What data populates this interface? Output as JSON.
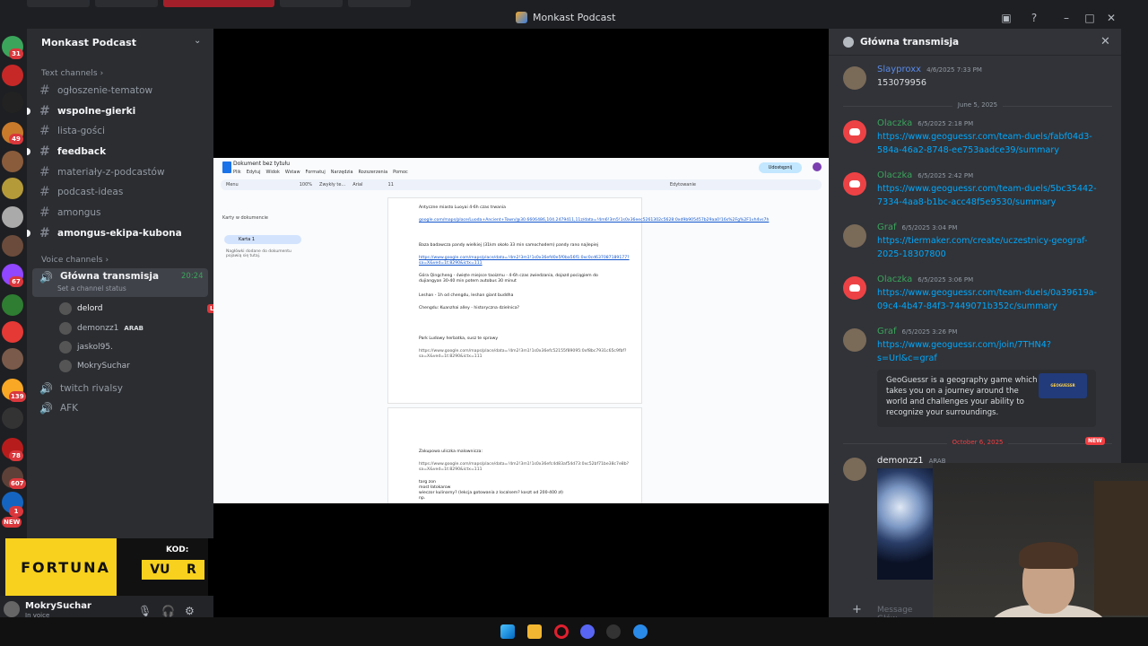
{
  "window": {
    "title": "Monkast Podcast"
  },
  "guild_badges": [
    "31",
    "49",
    "67",
    "139",
    "78",
    "607",
    "1",
    "NEW"
  ],
  "server": {
    "name": "Monkast Podcast",
    "text_category": "Text channels",
    "text_channels": [
      {
        "name": "ogłoszenie-tematow",
        "unread": false
      },
      {
        "name": "wspolne-gierki",
        "unread": true
      },
      {
        "name": "lista-gości",
        "unread": false
      },
      {
        "name": "feedback",
        "unread": true
      },
      {
        "name": "materiały-z-podcastów",
        "unread": false
      },
      {
        "name": "podcast-ideas",
        "unread": false
      },
      {
        "name": "amongus",
        "unread": false
      },
      {
        "name": "amongus-ekipa-kubona",
        "unread": true
      }
    ],
    "voice_category": "Voice channels",
    "active_voice": {
      "name": "Główna transmisja",
      "timer": "20:24",
      "status": "Set a channel status"
    },
    "voice_users": [
      {
        "name": "delord",
        "tag": "LIVE"
      },
      {
        "name": "demonzz1",
        "tag": "ARAB"
      },
      {
        "name": "jaskol95.",
        "tag": ""
      },
      {
        "name": "MokrySuchar",
        "tag": ""
      }
    ],
    "voice_channels": [
      "twitch rivalsy",
      "AFK"
    ]
  },
  "ad": {
    "brand": "FORTUNA",
    "code_label": "KOD:",
    "code_left": "VU",
    "code_right": "R"
  },
  "user": {
    "name": "MokrySuchar",
    "status": "In voice"
  },
  "docs": {
    "title": "Dokument bez tytułu",
    "menus": [
      "Plik",
      "Edytuj",
      "Widok",
      "Wstaw",
      "Formatuj",
      "Narzędzia",
      "Rozszerzenia",
      "Pomoc"
    ],
    "share": "Udostępnij",
    "toolbar": [
      "Menu",
      "100%",
      "Zwykły te...",
      "Arial",
      "11",
      "Edytowanie"
    ],
    "side_title": "Karty w dokumencie",
    "side_tab": "Karta 1",
    "side_hint": "Nagłówki dodane do dokumentu pojawią się tutaj.",
    "lines": [
      {
        "text": "Antyczne miasto Luoyai 4-6h czas trwania",
        "kind": "plain"
      },
      {
        "text": "google.com/maps/place/Luoda+Ancient+Town/@30.6606486,104.2479411,11z/data=!4m6!3m5!1s0x36eec5261302c5628:0xd9b905457b29aa0!16s%2Fg%2F1vh4vs7h",
        "kind": "link"
      },
      {
        "text": "Baza badawcza pandy wielkiej (31km około 33 min samochodem) pandy rano najlepiej",
        "kind": "plain"
      },
      {
        "text": "https://www.google.com/maps/place/data=!4m2!3m1!1s0x36efd0e5f0ba56f1:0xc0cd637087189177?sa=X&ved=1t:8290&ictx=111",
        "kind": "link"
      },
      {
        "text": "Góra Qingcheng - święte miejsce taoizmu - 4-6h czas zwiedzania, dojazd pociągiem do dujiangyan 30-40 min potem autobus 30 minut",
        "kind": "plain"
      },
      {
        "text": "Leshan - 1h od chengdu, leshan giant buddha",
        "kind": "plain"
      },
      {
        "text": "Chengdu: Kuanzhai alley - historyczna dzielnica?",
        "kind": "plain"
      },
      {
        "text": "Park Ludowy herbatka, susz te sprawy",
        "kind": "plain"
      },
      {
        "text": "https://www.google.com/maps/place/data=!4m2!3m1!1s0x36efc52155f89095:0xf8bc7931c65c9fbf?sa=X&ved=1t:8290&ictx=111",
        "kind": "gray"
      },
      {
        "text": "Zakupowa uliczka malownicza:",
        "kind": "plain"
      },
      {
        "text": "https://www.google.com/maps/place/data=!4m2!3m1!1s0x36efc4d83af54d73:0xc52bf71be38c7e8b?sa=X&ved=1t:8290&ictx=111",
        "kind": "gray"
      },
      {
        "text": "targ zon",
        "kind": "plain"
      },
      {
        "text": "most łatokarow",
        "kind": "plain"
      },
      {
        "text": "wieczor kulinarny? (lekcja gotowania z localsem? koszt od 200-400 zł)",
        "kind": "plain"
      },
      {
        "text": "np.",
        "kind": "plain"
      }
    ]
  },
  "chat": {
    "title": "Główna transmisja",
    "messages": [
      {
        "author": "Slayproxx",
        "time": "4/6/2025 7:33 PM",
        "text": "153079956",
        "color": "blue",
        "avatar": "img"
      },
      {
        "author": "Olaczka",
        "time": "6/5/2025 2:18 PM",
        "text": "https://www.geoguessr.com/team-duels/fabf04d3-584a-46a2-8748-ee753aadce39/summary",
        "color": "green",
        "avatar": "dc"
      },
      {
        "author": "Olaczka",
        "time": "6/5/2025 2:42 PM",
        "text": "https://www.geoguessr.com/team-duels/5bc35442-7334-4aa8-b1bc-acc48f5e9530/summary",
        "color": "green",
        "avatar": "dc"
      },
      {
        "author": "Graf",
        "time": "6/5/2025 3:04 PM",
        "text": "https://tiermaker.com/create/uczestnicy-geograf-2025-18307800",
        "color": "green",
        "avatar": "img"
      },
      {
        "author": "Olaczka",
        "time": "6/5/2025 3:06 PM",
        "text": "https://www.geoguessr.com/team-duels/0a39619a-09c4-4b47-84f3-7449071b352c/summary",
        "color": "green",
        "avatar": "dc"
      },
      {
        "author": "Graf",
        "time": "6/5/2025 3:26 PM",
        "text": "https://www.geoguessr.com/join/7THN4?s=Url&c=graf",
        "color": "green",
        "avatar": "img"
      }
    ],
    "date_sep_1": "June 5, 2025",
    "date_sep_2": "October 6, 2025",
    "new_tag": "NEW",
    "embed_text": "GeoGuessr is a geography game which takes you on a journey around the world and challenges your ability to recognize your surroundings.",
    "embed_logo": "GEOGUESSR",
    "last_author": "demonzz1",
    "last_tag": "ARAB",
    "input_placeholder": "Message Głów"
  },
  "colors": {
    "discord_bg": "#313338",
    "sidebar": "#2b2d31",
    "accent_red": "#da373c",
    "link": "#00a8fc"
  }
}
